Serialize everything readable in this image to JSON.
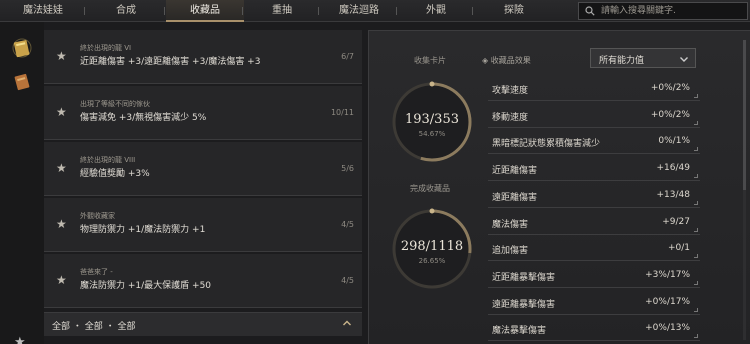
{
  "nav": {
    "tabs": [
      "魔法娃娃",
      "合成",
      "收藏品",
      "重抽",
      "魔法迴路",
      "外觀",
      "探險"
    ],
    "active_index": 2
  },
  "search": {
    "placeholder": "請輸入搜尋關鍵字."
  },
  "collection_list": [
    {
      "subtitle": "終於出現的龍 VI",
      "text": "近距離傷害 +3/遠距離傷害 +3/魔法傷害 +3",
      "count": "6/7"
    },
    {
      "subtitle": "出現了等級不同的傢伙",
      "text": "傷害減免 +3/無視傷害減少 5%",
      "count": "10/11"
    },
    {
      "subtitle": "終於出現的龍 VIII",
      "text": "經驗值獎勵 +3%",
      "count": "5/6"
    },
    {
      "subtitle": "外觀收藏家",
      "text": "物理防禦力 +1/魔法防禦力 +1",
      "count": "4/5"
    },
    {
      "subtitle": "爸爸來了 -",
      "text": "魔法防禦力 +1/最大保護盾 +50",
      "count": "4/5"
    }
  ],
  "filter": {
    "label": "全部 ・ 全部 ・ 全部"
  },
  "summary": {
    "cards_label": "收集卡片",
    "cards_value": "193/353",
    "cards_percent": "54.67%",
    "cards_fraction": 0.5467,
    "done_label": "完成收藏品",
    "done_value": "298/1118",
    "done_percent": "26.65%",
    "done_fraction": 0.2665
  },
  "effects": {
    "header": "收藏品效果",
    "dropdown_value": "所有能力值",
    "stats": [
      {
        "name": "攻擊速度",
        "value": "+0%/2%"
      },
      {
        "name": "移動速度",
        "value": "+0%/2%"
      },
      {
        "name": "黑暗標記狀態累積傷害減少",
        "value": "0%/1%"
      },
      {
        "name": "近距離傷害",
        "value": "+16/49"
      },
      {
        "name": "遠距離傷害",
        "value": "+13/48"
      },
      {
        "name": "魔法傷害",
        "value": "+9/27"
      },
      {
        "name": "追加傷害",
        "value": "+0/1"
      },
      {
        "name": "近距離暴擊傷害",
        "value": "+3%/17%"
      },
      {
        "name": "遠距離暴擊傷害",
        "value": "+0%/17%"
      },
      {
        "name": "魔法暴擊傷害",
        "value": "+0%/13%"
      }
    ]
  },
  "colors": {
    "accent": "#a8906a",
    "ring": "#8c7b5e",
    "bg": "#1c1c1e"
  }
}
